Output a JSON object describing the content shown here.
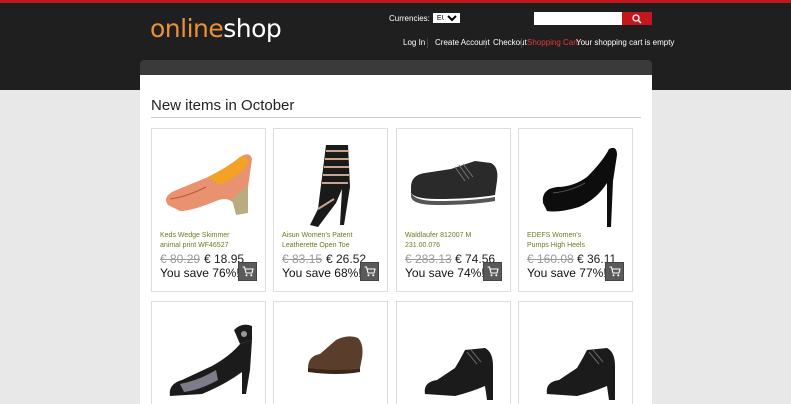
{
  "header": {
    "logo_part1": "online",
    "logo_part2": "shop",
    "currency_label": "Currencies:",
    "currency_value": "EUR",
    "search_placeholder": "",
    "nav": {
      "login": "Log In",
      "create_account": "Create Account",
      "checkout": "Checkout",
      "shopping_cart": "Shopping Cart:",
      "cart_status": "Your shopping cart is empty"
    }
  },
  "main": {
    "heading": "New items in October"
  },
  "products": [
    {
      "name": "Keds Wedge Skimmer animal print WF46527",
      "old_price": "€ 80.29",
      "new_price": "€ 18.95",
      "save": "You save 76%!"
    },
    {
      "name": "Aisun Women's Patent Leatherette Open Toe T-",
      "old_price": "€ 83.15",
      "new_price": "€ 26.52",
      "save": "You save 68%!"
    },
    {
      "name": "Waldlaufer 812007 M 231.00.076 8076NWRFEB",
      "old_price": "€ 283.13",
      "new_price": "€ 74.56",
      "save": "You save 74%!"
    },
    {
      "name": "EDEFS Women's Pumps High Heels Plateau",
      "old_price": "€ 160.08",
      "new_price": "€ 36.11",
      "save": "You save 77%!"
    }
  ],
  "colors": {
    "accent": "#c4161c",
    "logo_orange": "#e8913a",
    "header_bg": "#1f1f1f",
    "product_name": "#6f7a1d"
  }
}
